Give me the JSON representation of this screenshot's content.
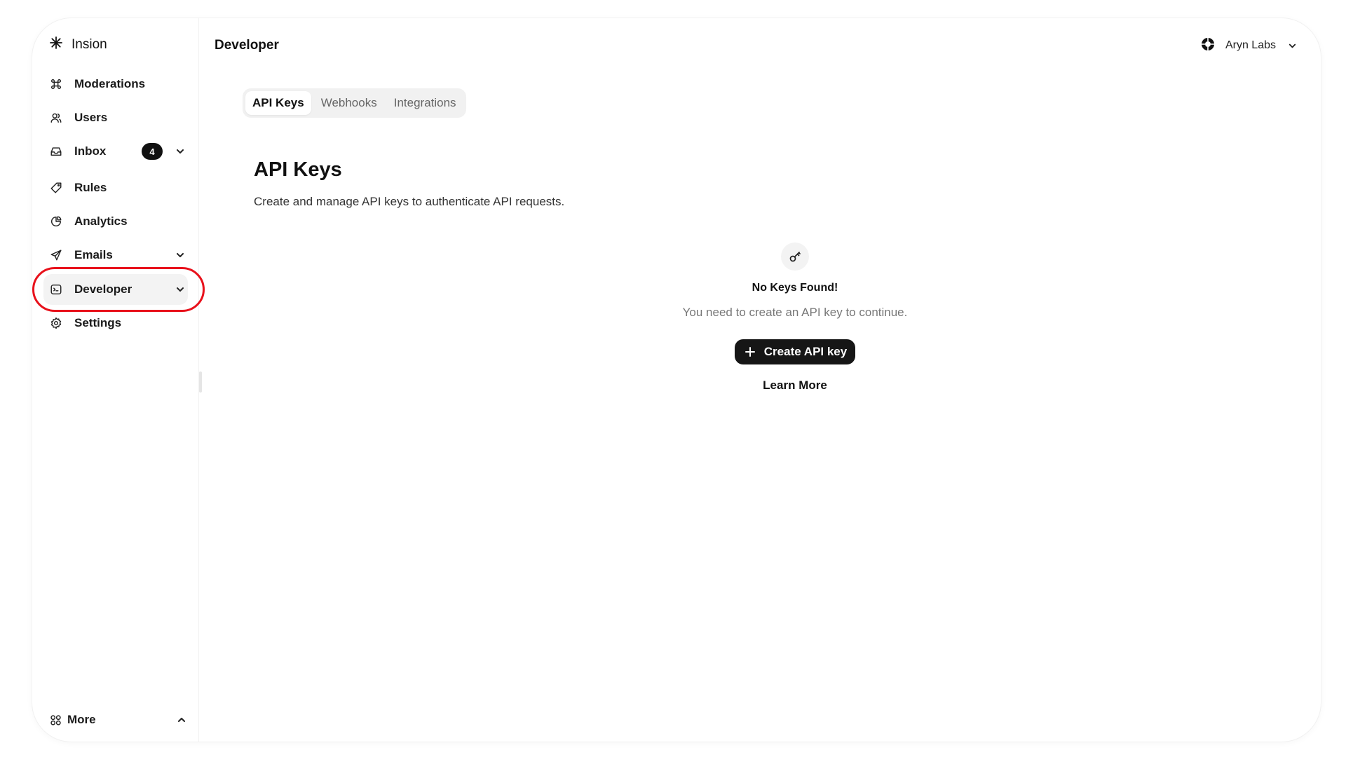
{
  "brand": {
    "name": "Insion"
  },
  "sidebar": {
    "items": [
      {
        "label": "Moderations"
      },
      {
        "label": "Users"
      },
      {
        "label": "Inbox",
        "badge": "4"
      },
      {
        "label": "Rules"
      },
      {
        "label": "Analytics"
      },
      {
        "label": "Emails"
      },
      {
        "label": "Developer"
      },
      {
        "label": "Settings"
      }
    ],
    "more_label": "More",
    "active_item": "Developer"
  },
  "header": {
    "title": "Developer",
    "org_name": "Aryn Labs"
  },
  "tabs": [
    {
      "label": "API Keys",
      "active": true
    },
    {
      "label": "Webhooks",
      "active": false
    },
    {
      "label": "Integrations",
      "active": false
    }
  ],
  "section": {
    "title": "API Keys",
    "description": "Create and manage API keys to authenticate API requests."
  },
  "empty_state": {
    "icon": "key-icon",
    "title": "No Keys Found!",
    "description": "You need to create an API key to continue.",
    "create_label": "Create API key",
    "learn_more_label": "Learn More"
  },
  "colors": {
    "highlight": "#e8111b",
    "primary_button": "#161616",
    "badge": "#111111"
  }
}
